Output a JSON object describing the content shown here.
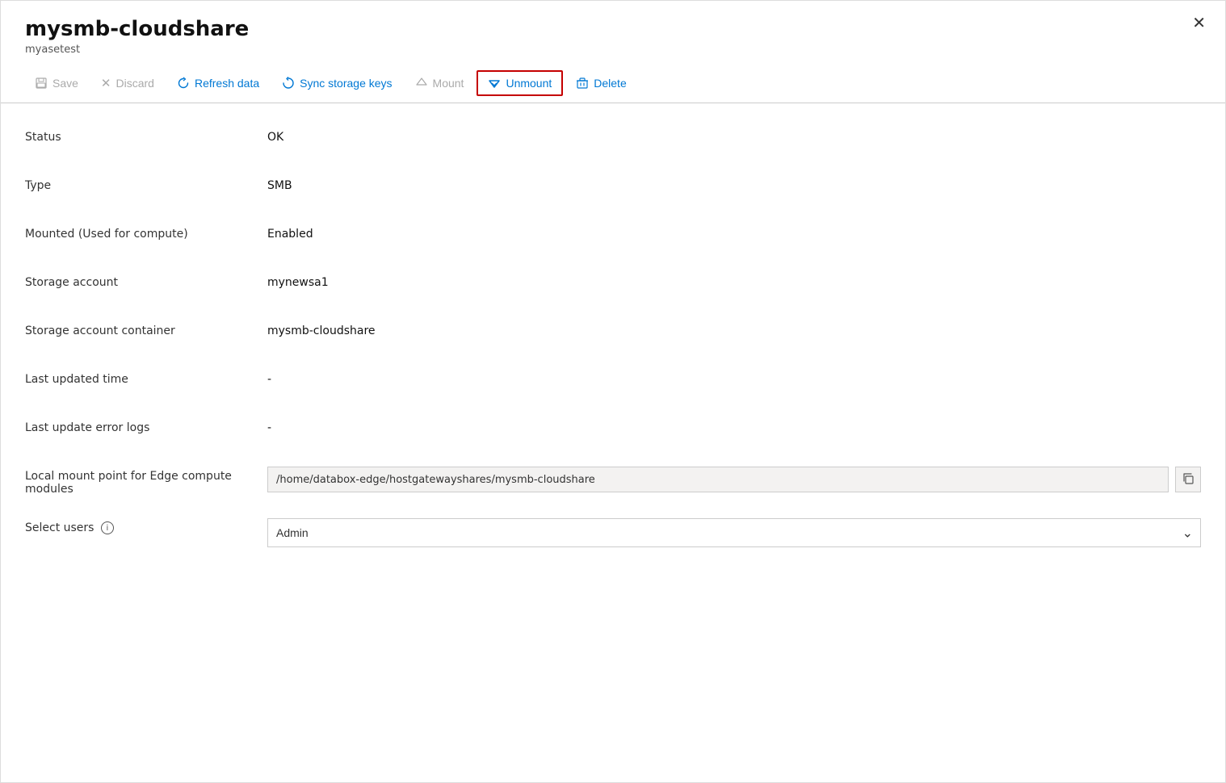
{
  "panel": {
    "title": "mysmb-cloudshare",
    "subtitle": "myasetest",
    "close_label": "✕"
  },
  "toolbar": {
    "save_label": "Save",
    "discard_label": "Discard",
    "refresh_label": "Refresh data",
    "sync_label": "Sync storage keys",
    "mount_label": "Mount",
    "unmount_label": "Unmount",
    "delete_label": "Delete"
  },
  "fields": {
    "status_label": "Status",
    "status_value": "OK",
    "type_label": "Type",
    "type_value": "SMB",
    "mounted_label": "Mounted (Used for compute)",
    "mounted_value": "Enabled",
    "storage_account_label": "Storage account",
    "storage_account_value": "mynewsa1",
    "storage_container_label": "Storage account container",
    "storage_container_value": "mysmb-cloudshare",
    "last_updated_label": "Last updated time",
    "last_updated_value": "-",
    "last_error_label": "Last update error logs",
    "last_error_value": "-",
    "local_mount_label": "Local mount point for Edge compute modules",
    "local_mount_value": "/home/databox-edge/hostgatewayshares/mysmb-cloudshare",
    "select_users_label": "Select users",
    "select_users_value": "Admin",
    "copy_icon": "⧉",
    "chevron_down": "⌄"
  }
}
